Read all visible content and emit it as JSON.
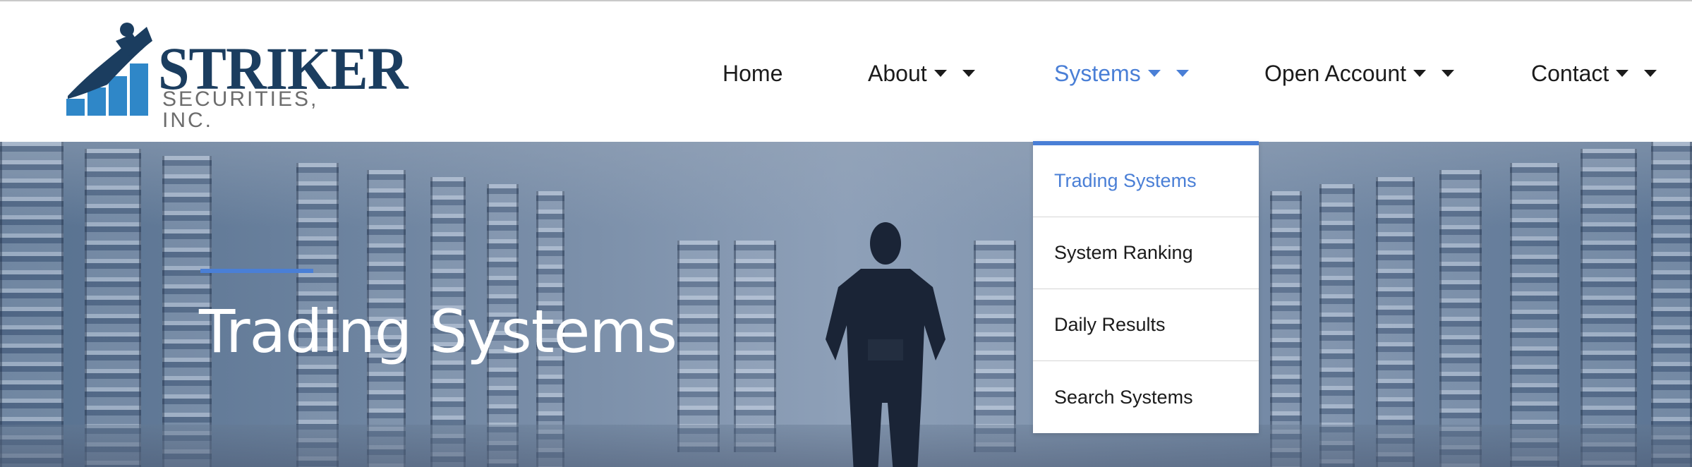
{
  "logo": {
    "name": "STRIKER",
    "subtitle": "SECURITIES, INC."
  },
  "nav": {
    "items": [
      {
        "label": "Home"
      },
      {
        "label": "About"
      },
      {
        "label": "Systems"
      },
      {
        "label": "Open Account"
      },
      {
        "label": "Contact"
      }
    ],
    "active_index": 2
  },
  "dropdown": {
    "items": [
      {
        "label": "Trading Systems"
      },
      {
        "label": "System Ranking"
      },
      {
        "label": "Daily Results"
      },
      {
        "label": "Search Systems"
      }
    ],
    "active_index": 0
  },
  "hero": {
    "title": "Trading Systems"
  },
  "colors": {
    "accent": "#4a7fd6",
    "brand_navy": "#1b3d5f",
    "logo_blue": "#2f87c8",
    "text": "#1b1b1b"
  }
}
